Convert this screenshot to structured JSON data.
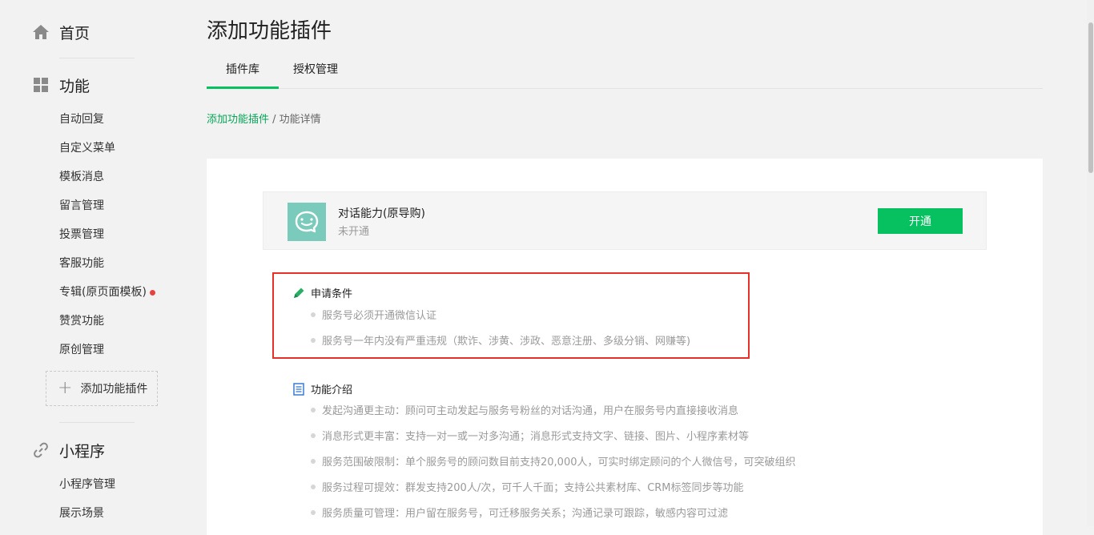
{
  "sidebar": {
    "home": {
      "label": "首页",
      "icon": "home-icon"
    },
    "function": {
      "label": "功能",
      "icon": "grid-icon",
      "items": [
        "自动回复",
        "自定义菜单",
        "模板消息",
        "留言管理",
        "投票管理",
        "客服功能",
        "专辑(原页面模板)",
        "赞赏功能",
        "原创管理"
      ],
      "add_plugin_label": "添加功能插件"
    },
    "miniprogram": {
      "label": "小程序",
      "icon": "link-icon",
      "items": [
        "小程序管理",
        "展示场景"
      ]
    }
  },
  "page": {
    "title": "添加功能插件",
    "tabs": [
      {
        "label": "插件库",
        "active": true
      },
      {
        "label": "授权管理",
        "active": false
      }
    ],
    "breadcrumb": {
      "link": "添加功能插件",
      "separator": " / ",
      "current": "功能详情"
    }
  },
  "plugin": {
    "name": "对话能力(原导购)",
    "status": "未开通",
    "open_label": "开通"
  },
  "conditions": {
    "title": "申请条件",
    "items": [
      "服务号必须开通微信认证",
      "服务号一年内没有严重违规（欺诈、涉黄、涉政、恶意注册、多级分销、网赚等)"
    ]
  },
  "intro": {
    "title": "功能介绍",
    "items": [
      "发起沟通更主动：顾问可主动发起与服务号粉丝的对话沟通，用户在服务号内直接接收消息",
      "消息形式更丰富：支持一对一或一对多沟通；消息形式支持文字、链接、图片、小程序素材等",
      "服务范围破限制：单个服务号的顾问数目前支持20,000人，可实时绑定顾问的个人微信号，可突破组织",
      "服务过程可提效：群发支持200人/次，可千人千面；支持公共素材库、CRM标签同步等功能",
      "服务质量可管理：用户留在服务号，可迁移服务关系；沟通记录可跟踪，敏感内容可过滤"
    ]
  },
  "colors": {
    "accent": "#07c160",
    "highlight": "#e8302a",
    "badge": "#e64340"
  }
}
